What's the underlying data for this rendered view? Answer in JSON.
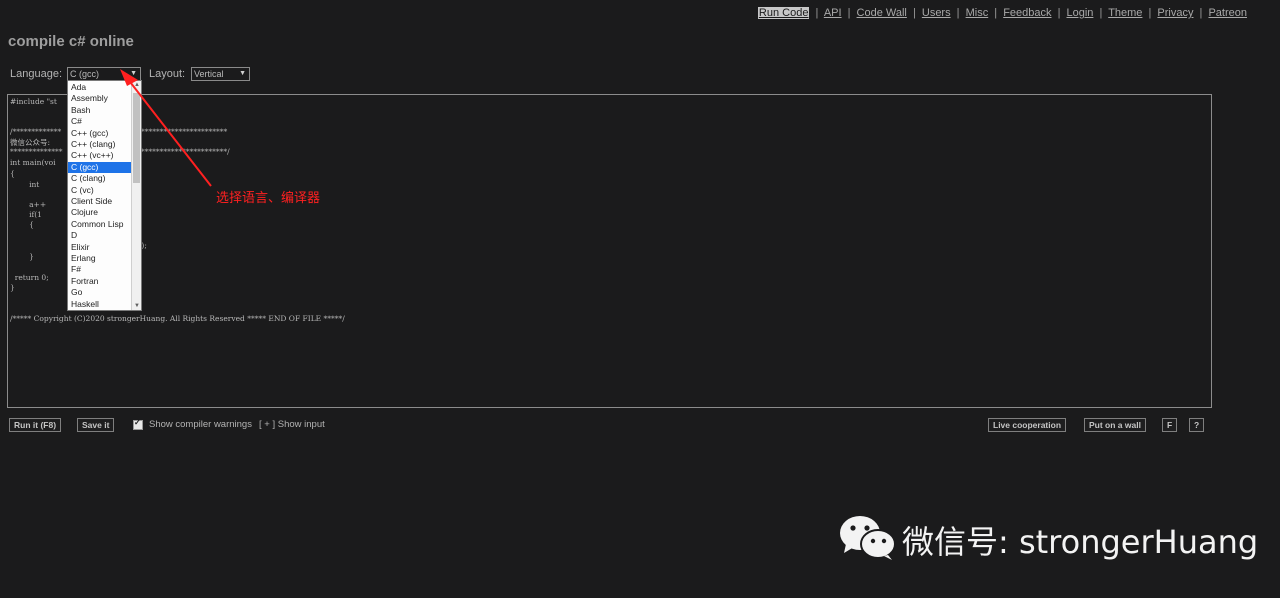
{
  "nav": {
    "items": [
      {
        "label": "Run Code",
        "active": true
      },
      {
        "label": "API"
      },
      {
        "label": "Code Wall"
      },
      {
        "label": "Users"
      },
      {
        "label": "Misc"
      },
      {
        "label": "Feedback"
      },
      {
        "label": "Login"
      },
      {
        "label": "Theme"
      },
      {
        "label": "Privacy"
      },
      {
        "label": "Patreon"
      }
    ],
    "separator": "|"
  },
  "page": {
    "title": "compile c# online"
  },
  "language": {
    "label": "Language:",
    "selected": "C (gcc)"
  },
  "layout": {
    "label": "Layout:",
    "selected": "Vertical"
  },
  "dropdown": {
    "options": [
      "Ada",
      "Assembly",
      "Bash",
      "C#",
      "C++ (gcc)",
      "C++ (clang)",
      "C++ (vc++)",
      "C (gcc)",
      "C (clang)",
      "C (vc)",
      "Client Side",
      "Clojure",
      "Common Lisp",
      "D",
      "Elixir",
      "Erlang",
      "F#",
      "Fortran",
      "Go",
      "Haskell"
    ],
    "selected_index": 7
  },
  "editor": {
    "lines": [
      "#include \"st",
      "",
      "",
      "/*************                        *****************************",
      "微信公众号:",
      "**************                         ****************************/",
      "int main(voi",
      "{",
      "        int",
      "",
      "        a++",
      "        if(1",
      "        {",
      "",
      "                                          %d\", &a);",
      "",
      "        }",
      "",
      "  return 0;",
      "}",
      "",
      "",
      "/***** Copyright (C)2020 strongerHuang. All Rights Reserved ***** END OF FILE *****/"
    ]
  },
  "annotation": {
    "text": "选择语言、编译器",
    "color": "#ff2020"
  },
  "toolbar": {
    "run_label": "Run it (F8)",
    "save_label": "Save it",
    "warnings_label": "Show compiler warnings",
    "warnings_checked": true,
    "show_input_label": "[ + ] Show input",
    "live_label": "Live cooperation",
    "wall_label": "Put on a wall",
    "f_label": "F",
    "help_label": "?"
  },
  "watermark": {
    "text": "微信号: strongerHuang"
  }
}
